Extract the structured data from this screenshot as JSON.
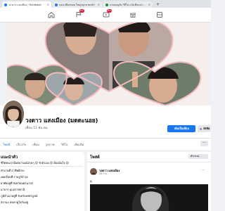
{
  "browser": {
    "tabs": [
      {
        "label": "วง ดาว แสงเมือง | Facebook",
        "favicon_color": "#1877f2",
        "active": true
      },
      {
        "label": "กองเปลือกหอย ใหญ่ๆบุกหาดหน้า",
        "favicon_color": "#1877f2",
        "active": false
      },
      {
        "label": "เกมผจญภัย วิดีโอ แจ้งเตือนน่าดูเล่น",
        "favicon_color": "#1e8e3e",
        "active": false
      }
    ],
    "new_tab": "+",
    "close": "×"
  },
  "topbar": {
    "icons": [
      {
        "name": "home-icon"
      },
      {
        "name": "friends-icon",
        "badge": "9+"
      },
      {
        "name": "watch-icon",
        "badge": "9+"
      },
      {
        "name": "marketplace-icon"
      },
      {
        "name": "groups-icon"
      }
    ],
    "accent": "#1877f2"
  },
  "profile": {
    "name": "วงดาว แสงเมือง (มดตะนอย)",
    "friends": "เพื่อน 11 พัน คน",
    "add_friend_label": "เพิ่มเป็นเพื่อน",
    "message_label": "ส่งข้อ"
  },
  "tabs": [
    {
      "label": "โพสต์",
      "active": true
    },
    {
      "label": "เกี่ยวกับ",
      "active": false
    },
    {
      "label": "เพื่อน",
      "active": false
    },
    {
      "label": "รูปภาพ",
      "active": false
    },
    {
      "label": "วิดีโอ",
      "active": false
    },
    {
      "label": "เพิ่มเติม",
      "active": false
    }
  ],
  "more_tabs": "···",
  "intro": {
    "title": "แนะนำตัว",
    "bio": "ชีวิตคนเรามีแต่อารมณ์สวยๆ 😍 รักตัวเอง 😍 ต้องมั่นใจ 😍",
    "rows": [
      "ทำงานที่ อาชีพอิสระ",
      "เคยเรียนที่ ราษฎร์บำรุง",
      "อาศัยอยู่ที่ จังหวัดนครนายก",
      "มาจาก อุบลราชธานี",
      "ภูมิลำเนาอยู่ที่ จังหวัดเพชรบูรณ์",
      "สถานะ คบหาดูใจกันอยู่"
    ]
  },
  "posts": {
    "title": "โพสต์",
    "filter_label": "ตัวกรอง",
    "author": "วงดาว แสงเมือง",
    "date": "20 ก.ย.",
    "text": "ดุ"
  }
}
